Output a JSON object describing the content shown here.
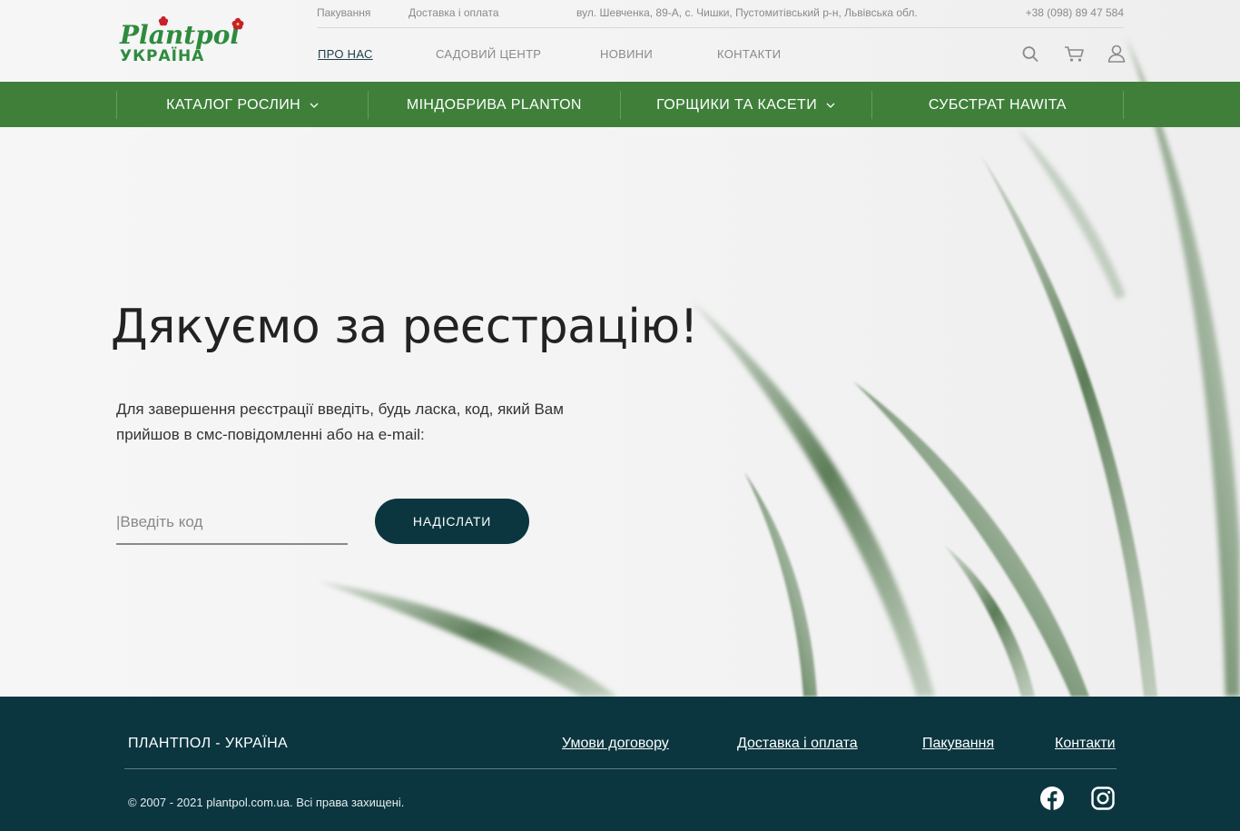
{
  "brand": {
    "logo_text": "Plantpol",
    "logo_subtext": "УКРАЇНА"
  },
  "topbar": {
    "link_packaging": "Пакування",
    "link_delivery": "Доставка і оплата",
    "address": "вул. Шевченка, 89-А, с. Чишки, Пустомитівський р-н, Львівська обл.",
    "phone": "+38 (098) 89 47 584"
  },
  "mainnav": {
    "about": "ПРО НАС",
    "garden": "САДОВИЙ ЦЕНТР",
    "news": "НОВИНИ",
    "contacts": "КОНТАКТИ"
  },
  "header_icons": [
    "search-icon",
    "cart-icon",
    "user-icon"
  ],
  "catalog_nav": [
    {
      "label": "КАТАЛОГ РОСЛИН",
      "has_dropdown": true
    },
    {
      "label": "МІНДОБРИВА PLANTON",
      "has_dropdown": false
    },
    {
      "label": "ГОРЩИКИ ТА КАСЕТИ",
      "has_dropdown": true
    },
    {
      "label": "СУБСТРАТ HAWITA",
      "has_dropdown": false
    }
  ],
  "main": {
    "title": "Дякуємо за реєстрацію!",
    "description": "Для завершення реєстрації введіть, будь ласка, код, який Вам прийшов в смс-повідомленні або на e-mail:",
    "code_placeholder": "|Введіть код",
    "code_value": "",
    "submit_label": "НАДІСЛАТИ"
  },
  "footer": {
    "title": "ПЛАНТПОЛ - УКРАЇНА",
    "links": {
      "terms": "Умови договору",
      "delivery": "Доставка і оплата",
      "packaging": "Пакування",
      "contacts": "Контакти"
    },
    "copyright": "© 2007 - 2021 plantpol.com.ua. Всі права захищені.",
    "social": [
      "facebook-icon",
      "instagram-icon"
    ]
  },
  "colors": {
    "green_bar": "#3f7f3a",
    "footer_bg": "#0b3640",
    "button_bg": "#0b3640",
    "logo_green": "#2e8b3e",
    "logo_red": "#c8202a"
  }
}
